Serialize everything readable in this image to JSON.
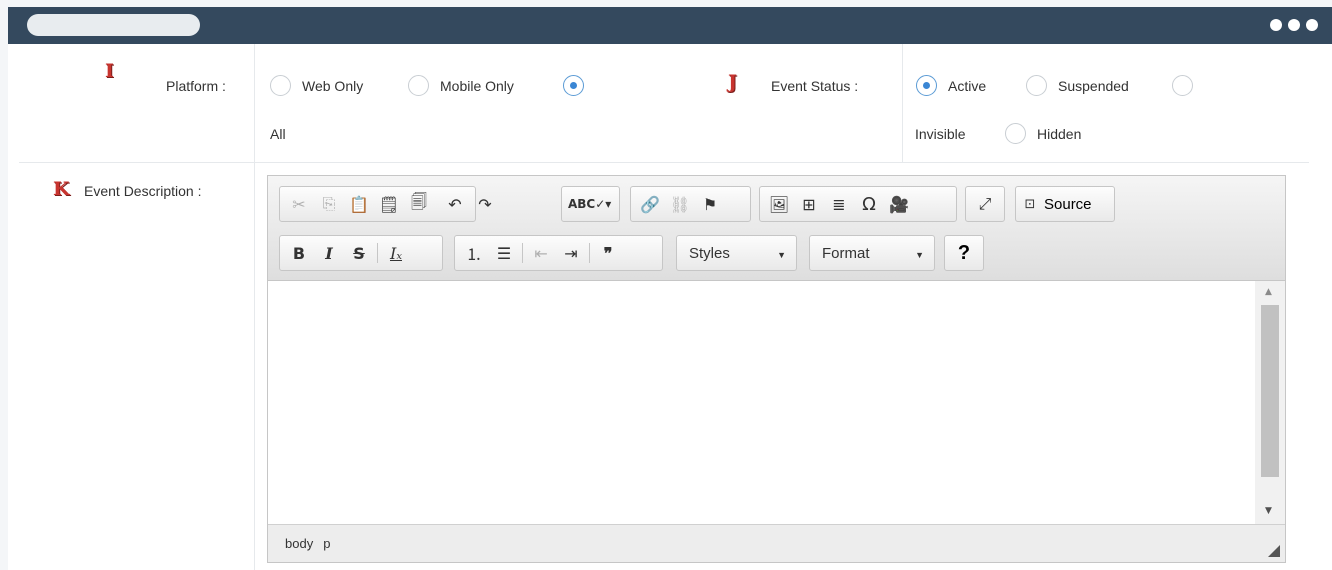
{
  "form": {
    "platform": {
      "badge": "I",
      "label": "Platform :",
      "options": [
        "Web Only",
        "Mobile Only",
        "All"
      ],
      "selected": "All"
    },
    "event_status": {
      "badge": "J",
      "label": "Event Status :",
      "options": [
        "Active",
        "Suspended",
        "Invisible",
        "Hidden"
      ],
      "selected": "Active"
    },
    "event_description": {
      "badge": "K",
      "label": "Event Description :"
    }
  },
  "editor": {
    "styles_label": "Styles",
    "format_label": "Format",
    "source_label": "Source",
    "help_label": "?",
    "bold": "B",
    "italic": "I",
    "strike": "S",
    "path": [
      "body",
      "p"
    ]
  },
  "colors": {
    "titlebar": "#34495e",
    "badge": "#c8342f",
    "radio_checked": "#3a86d4"
  }
}
